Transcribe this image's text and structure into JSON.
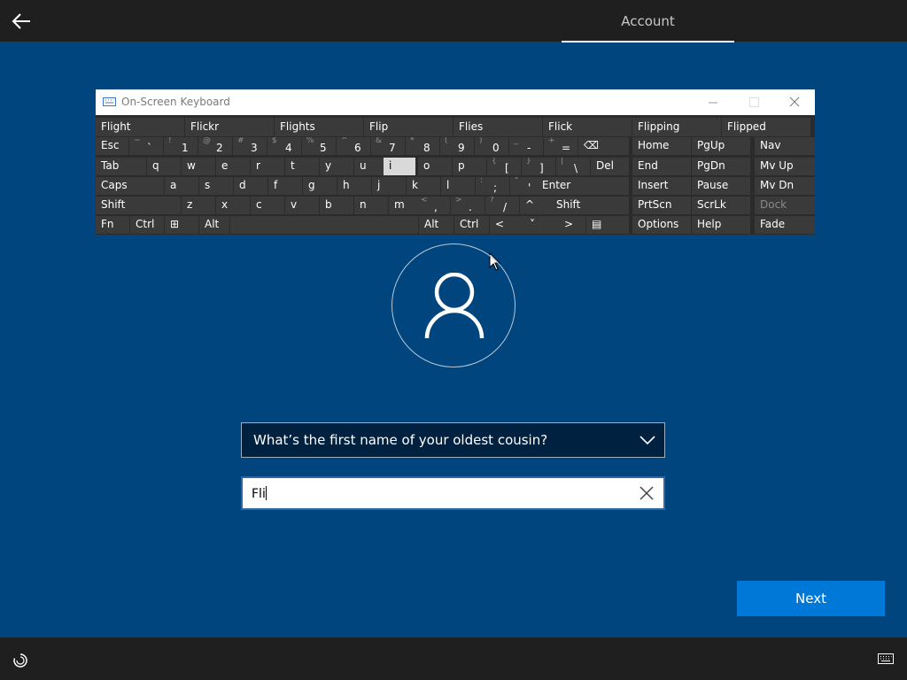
{
  "header": {
    "tab_label": "Account"
  },
  "osk": {
    "title": "On-Screen Keyboard",
    "predictions": [
      "Flight",
      "Flickr",
      "Flights",
      "Flip",
      "Flies",
      "Flick",
      "Flipping",
      "Flipped"
    ],
    "row1": [
      {
        "l": "Esc"
      },
      {
        "p": "~",
        "m": "`"
      },
      {
        "p": "!",
        "m": "1"
      },
      {
        "p": "@",
        "m": "2"
      },
      {
        "p": "#",
        "m": "3"
      },
      {
        "p": "$",
        "m": "4"
      },
      {
        "p": "%",
        "m": "5"
      },
      {
        "p": "^",
        "m": "6"
      },
      {
        "p": "&",
        "m": "7"
      },
      {
        "p": "*",
        "m": "8"
      },
      {
        "p": "(",
        "m": "9"
      },
      {
        "p": ")",
        "m": "0"
      },
      {
        "p": "_",
        "m": "-"
      },
      {
        "p": "+",
        "m": "="
      },
      {
        "l": "⌫"
      },
      {
        "l": "Home"
      },
      {
        "l": "PgUp"
      },
      {
        "l": "Nav"
      }
    ],
    "row2": [
      {
        "l": "Tab"
      },
      {
        "l": "q"
      },
      {
        "l": "w"
      },
      {
        "l": "e"
      },
      {
        "l": "r"
      },
      {
        "l": "t"
      },
      {
        "l": "y"
      },
      {
        "l": "u"
      },
      {
        "l": "i"
      },
      {
        "l": "o"
      },
      {
        "l": "p"
      },
      {
        "p": "{",
        "m": "["
      },
      {
        "p": "}",
        "m": "]"
      },
      {
        "p": "|",
        "m": "\\"
      },
      {
        "l": "Del"
      },
      {
        "l": "End"
      },
      {
        "l": "PgDn"
      },
      {
        "l": "Mv Up"
      }
    ],
    "row3": [
      {
        "l": "Caps"
      },
      {
        "l": "a"
      },
      {
        "l": "s"
      },
      {
        "l": "d"
      },
      {
        "l": "f"
      },
      {
        "l": "g"
      },
      {
        "l": "h"
      },
      {
        "l": "j"
      },
      {
        "l": "k"
      },
      {
        "l": "l"
      },
      {
        "p": ":",
        "m": ";"
      },
      {
        "p": "\"",
        "m": "'"
      },
      {
        "l": "Enter"
      },
      {
        "l": "Insert"
      },
      {
        "l": "Pause"
      },
      {
        "l": "Mv Dn"
      }
    ],
    "row4": [
      {
        "l": "Shift"
      },
      {
        "l": "z"
      },
      {
        "l": "x"
      },
      {
        "l": "c"
      },
      {
        "l": "v"
      },
      {
        "l": "b"
      },
      {
        "l": "n"
      },
      {
        "l": "m"
      },
      {
        "p": "<",
        "m": ","
      },
      {
        "p": ">",
        "m": "."
      },
      {
        "p": "?",
        "m": "/"
      },
      {
        "l": "^"
      },
      {
        "l": "Shift"
      },
      {
        "l": "PrtScn"
      },
      {
        "l": "ScrLk"
      },
      {
        "l": "Dock"
      }
    ],
    "row5": [
      {
        "l": "Fn"
      },
      {
        "l": "Ctrl"
      },
      {
        "l": "⊞"
      },
      {
        "l": "Alt"
      },
      {
        "l": ""
      },
      {
        "l": "Alt"
      },
      {
        "l": "Ctrl"
      },
      {
        "l": "<"
      },
      {
        "l": "˅"
      },
      {
        "l": ">"
      },
      {
        "l": "▤"
      },
      {
        "l": "Options"
      },
      {
        "l": "Help"
      },
      {
        "l": "Fade"
      }
    ]
  },
  "question": {
    "selected": "What’s the first name of your oldest cousin?"
  },
  "answer": {
    "value": "Fli"
  },
  "next_label": "Next",
  "colors": {
    "background": "#00457d",
    "accent": "#0078d7",
    "bar": "#1f1f1f"
  }
}
